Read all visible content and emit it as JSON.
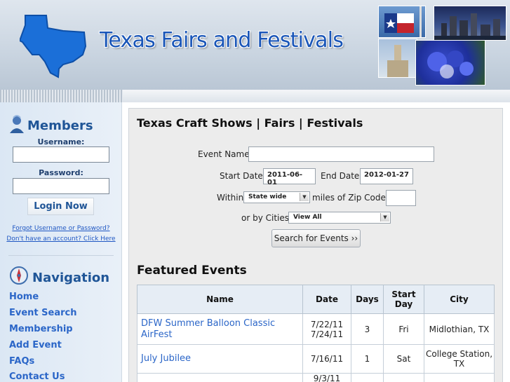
{
  "header": {
    "site_title": "Texas Fairs and Festivals"
  },
  "colors": {
    "brand_blue": "#1a56b8",
    "link_blue": "#2b66c8",
    "sidebar_bg": "#dbe7f4",
    "table_header_bg": "#e6edf5"
  },
  "sidebar": {
    "members": {
      "heading": "Members",
      "icon": "members-icon",
      "username_label": "Username:",
      "password_label": "Password:",
      "login_button": "Login Now",
      "forgot_link": "Forgot Username or Password?",
      "signup_link": "Don't have an account? Click Here"
    },
    "navigation": {
      "heading": "Navigation",
      "icon": "compass-icon",
      "items": [
        {
          "label": "Home"
        },
        {
          "label": "Event Search"
        },
        {
          "label": "Membership"
        },
        {
          "label": "Add Event"
        },
        {
          "label": "FAQs"
        },
        {
          "label": "Contact Us"
        }
      ]
    }
  },
  "main": {
    "title": "Texas Craft Shows | Fairs | Festivals",
    "search": {
      "event_name_label": "Event Name",
      "start_date_label": "Start Date",
      "start_date_value": "2011-06-01",
      "end_date_label": "End Date",
      "end_date_value": "2012-01-27",
      "within_label": "Within",
      "within_value": "State wide",
      "miles_label": "miles of Zip Code:",
      "cities_label": "or by Cities",
      "cities_value": "View All",
      "button_label": "Search for Events ››"
    },
    "featured": {
      "title": "Featured Events",
      "columns": {
        "name": "Name",
        "date": "Date",
        "days": "Days",
        "start_day": "Start Day",
        "city": "City"
      },
      "rows": [
        {
          "name": "DFW Summer Balloon Classic AirFest",
          "date": "7/22/11\n7/24/11",
          "days": "3",
          "start_day": "Fri",
          "city": "Midlothian, TX"
        },
        {
          "name": "July Jubilee",
          "date": "7/16/11",
          "days": "1",
          "start_day": "Sat",
          "city": "College Station, TX"
        },
        {
          "name": "",
          "date": "9/3/11",
          "days": "",
          "start_day": "",
          "city": ""
        }
      ]
    }
  }
}
